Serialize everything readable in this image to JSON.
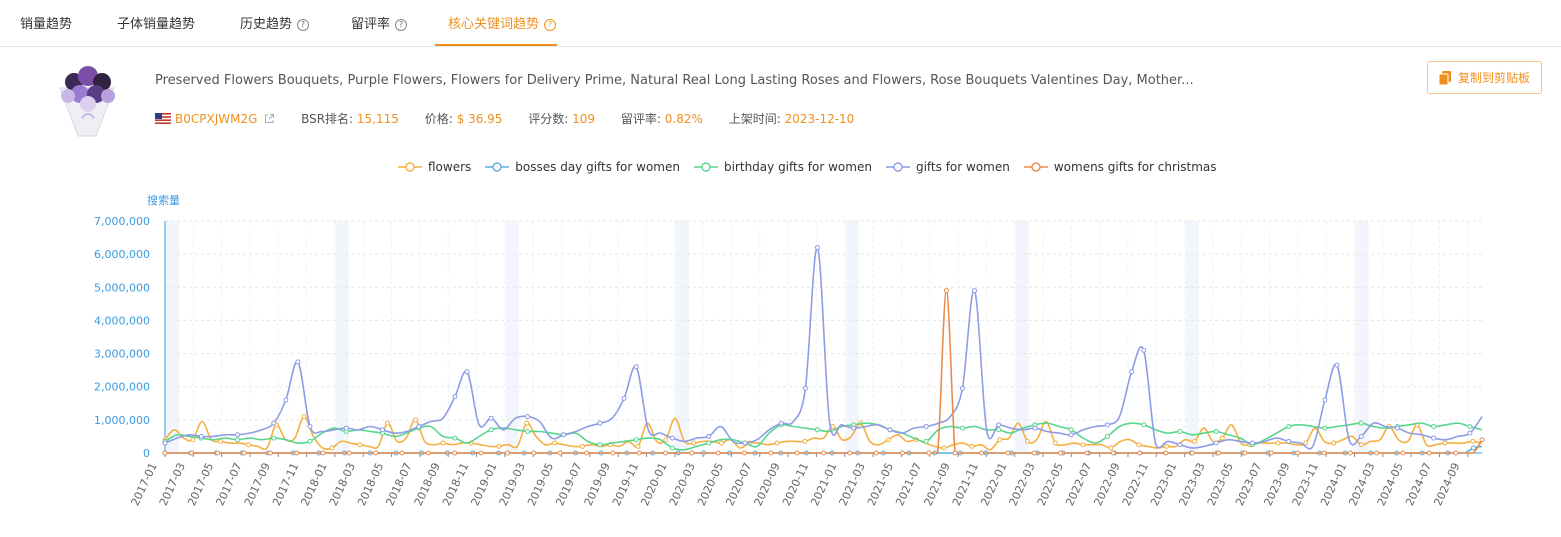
{
  "tabs": [
    {
      "label": "销量趋势",
      "help": false,
      "active": false
    },
    {
      "label": "子体销量趋势",
      "help": false,
      "active": false
    },
    {
      "label": "历史趋势",
      "help": true,
      "active": false
    },
    {
      "label": "留评率",
      "help": true,
      "active": false
    },
    {
      "label": "核心关键词趋势",
      "help": true,
      "active": true
    }
  ],
  "product": {
    "title": "Preserved Flowers Bouquets, Purple Flowers, Flowers for Delivery Prime, Natural Real Long Lasting Roses and Flowers, Rose Bouquets Valentines Day, Mother...",
    "asin": "B0CPXJWM2G",
    "bsr_label": "BSR排名:",
    "bsr_value": "15,115",
    "price_label": "价格:",
    "price_value": "$ 36.95",
    "reviews_label": "评分数:",
    "reviews_value": "109",
    "review_rate_label": "留评率:",
    "review_rate_value": "0.82%",
    "listed_label": "上架时间:",
    "listed_value": "2023-12-10"
  },
  "copy_button": {
    "label": "复制到剪贴板"
  },
  "colors": {
    "accent": "#f0901c",
    "axis": "#3a9be0"
  },
  "chart_data": {
    "type": "line",
    "ylabel": "搜索量",
    "ylim": [
      0,
      7000000
    ],
    "yticks": [
      "0",
      "1,000,000",
      "2,000,000",
      "3,000,000",
      "4,000,000",
      "5,000,000",
      "6,000,000",
      "7,000,000"
    ],
    "x_start": "2017-01",
    "x_end": "2024-10",
    "x_tick_labels": [
      "2017-01",
      "2017-03",
      "2017-05",
      "2017-07",
      "2017-09",
      "2017-11",
      "2018-01",
      "2018-03",
      "2018-05",
      "2018-07",
      "2018-09",
      "2018-11",
      "2019-01",
      "2019-03",
      "2019-05",
      "2019-07",
      "2019-09",
      "2019-11",
      "2020-01",
      "2020-03",
      "2020-05",
      "2020-07",
      "2020-09",
      "2020-11",
      "2021-01",
      "2021-03",
      "2021-05",
      "2021-07",
      "2021-09",
      "2021-11",
      "2022-01",
      "2022-03",
      "2022-05",
      "2022-07",
      "2022-09",
      "2022-11",
      "2023-01",
      "2023-03",
      "2023-05",
      "2023-07",
      "2023-09",
      "2023-11",
      "2024-01",
      "2024-03",
      "2024-05",
      "2024-07",
      "2024-09"
    ],
    "legend_position": "top",
    "series": [
      {
        "name": "flowers",
        "color": "#f5b041",
        "values": [
          400000,
          700000,
          450000,
          400000,
          950000,
          400000,
          350000,
          300000,
          300000,
          250000,
          200000,
          150000,
          850000,
          400000,
          450000,
          1100000,
          500000,
          150000,
          150000,
          350000,
          300000,
          250000,
          200000,
          200000,
          900000,
          350000,
          450000,
          1000000,
          350000,
          250000,
          300000,
          250000,
          300000,
          300000,
          250000,
          200000,
          200000,
          250000,
          200000,
          900000,
          500000,
          250000,
          300000,
          250000,
          200000,
          200000,
          250000,
          200000,
          250000,
          200000,
          350000,
          200000,
          900000,
          350000,
          400000,
          1050000,
          350000,
          300000,
          350000,
          350000,
          300000,
          400000,
          150000,
          300000,
          300000,
          250000,
          300000,
          350000,
          350000,
          350000,
          450000,
          450000,
          800000,
          400000,
          500000,
          900000,
          350000,
          250000,
          400000,
          550000,
          350000,
          400000,
          300000,
          200000,
          150000,
          250000,
          300000,
          200000,
          250000,
          100000,
          400000,
          450000,
          900000,
          350000,
          400000,
          950000,
          300000,
          250000,
          300000,
          250000,
          250000,
          250000,
          150000,
          350000,
          400000,
          250000,
          200000,
          150000,
          200000,
          200000,
          400000,
          350000,
          750000,
          350000,
          450000,
          850000,
          300000,
          250000,
          300000,
          300000,
          300000,
          300000,
          250000,
          300000,
          750000,
          350000,
          300000,
          400000,
          500000,
          250000,
          350000,
          400000,
          800000,
          400000,
          350000,
          850000,
          250000,
          250000,
          300000,
          300000,
          300000,
          350000,
          300000
        ]
      },
      {
        "name": "bosses day gifts for women",
        "color": "#5dade2",
        "values": [
          0,
          0,
          0,
          0,
          0,
          0,
          0,
          0,
          0,
          0,
          0,
          0,
          0,
          0,
          0,
          0,
          0,
          0,
          0,
          0,
          0,
          0,
          0,
          0,
          0,
          0,
          0,
          0,
          0,
          0,
          0,
          0,
          0,
          0,
          0,
          0,
          0,
          0,
          0,
          0,
          0,
          0,
          0,
          0,
          0,
          0,
          0,
          0,
          0,
          0,
          0,
          0,
          0,
          0,
          0,
          0,
          0,
          0,
          0,
          0,
          0,
          0,
          0,
          0,
          0,
          0,
          0,
          0,
          0,
          0,
          0,
          0,
          0,
          0,
          0,
          0,
          0,
          0,
          0,
          0,
          0,
          0,
          0,
          0,
          0,
          0,
          0,
          0,
          0,
          0,
          0,
          0,
          0,
          0,
          0,
          0,
          0,
          0,
          0,
          0,
          0,
          0,
          0,
          0,
          0,
          0,
          0,
          0,
          0,
          0,
          0,
          0,
          0,
          0,
          0,
          0,
          0,
          0,
          0,
          0,
          0,
          0,
          0,
          0,
          0,
          0,
          0,
          0,
          0,
          0,
          0,
          0,
          0,
          0,
          0,
          0,
          0,
          0,
          0,
          0,
          0,
          0,
          0,
          0,
          0,
          0,
          0,
          0,
          0,
          0,
          0,
          0,
          0,
          150000,
          200000
        ]
      },
      {
        "name": "birthday gifts for women",
        "color": "#58d68d",
        "values": [
          350000,
          550000,
          500000,
          450000,
          400000,
          450000,
          400000,
          450000,
          400000,
          450000,
          400000,
          300000,
          350000,
          600000,
          750000,
          650000,
          700000,
          650000,
          600000,
          500000,
          600000,
          750000,
          800000,
          500000,
          450000,
          300000,
          500000,
          700000,
          750000,
          700000,
          650000,
          650000,
          600000,
          550000,
          600000,
          350000,
          250000,
          300000,
          350000,
          400000,
          450000,
          400000,
          150000,
          100000,
          200000,
          300000,
          400000,
          400000,
          300000,
          200000,
          600000,
          850000,
          800000,
          750000,
          700000,
          650000,
          800000,
          850000,
          900000,
          850000,
          700000,
          600000,
          450000,
          350000,
          700000,
          800000,
          750000,
          800000,
          700000,
          700000,
          600000,
          750000,
          850000,
          900000,
          800000,
          700000,
          450000,
          300000,
          500000,
          800000,
          900000,
          850000,
          700000,
          600000,
          650000,
          550000,
          600000,
          650000,
          550000,
          450000,
          250000,
          400000,
          600000,
          800000,
          850000,
          800000,
          750000,
          800000,
          850000,
          900000,
          800000,
          750000,
          800000,
          850000,
          900000,
          800000,
          850000,
          900000,
          800000,
          700000
        ]
      },
      {
        "name": "gifts for women",
        "color": "#8e9ce6",
        "values": [
          300000,
          450000,
          550000,
          500000,
          500000,
          550000,
          550000,
          600000,
          700000,
          900000,
          1600000,
          2750000,
          800000,
          650000,
          700000,
          750000,
          700000,
          800000,
          700000,
          600000,
          650000,
          800000,
          950000,
          1050000,
          1700000,
          2450000,
          850000,
          1050000,
          700000,
          1050000,
          1100000,
          950000,
          450000,
          550000,
          650000,
          800000,
          900000,
          1050000,
          1650000,
          2600000,
          700000,
          600000,
          450000,
          350000,
          450000,
          500000,
          800000,
          350000,
          300000,
          400000,
          700000,
          900000,
          950000,
          1950000,
          6200000,
          950000,
          850000,
          750000,
          800000,
          850000,
          700000,
          600000,
          750000,
          800000,
          900000,
          1100000,
          1950000,
          4900000,
          700000,
          850000,
          750000,
          700000,
          750000,
          650000,
          600000,
          550000,
          700000,
          800000,
          850000,
          1100000,
          2450000,
          3100000,
          250000,
          350000,
          250000,
          150000,
          200000,
          300000,
          400000,
          350000,
          300000,
          350000,
          450000,
          350000,
          300000,
          200000,
          1600000,
          2650000,
          400000,
          500000,
          900000,
          800000,
          750000,
          600000,
          550000,
          450000,
          400000,
          500000,
          600000,
          1100000
        ]
      },
      {
        "name": "womens gifts for christmas",
        "color": "#eb8b4b",
        "values": [
          0,
          0,
          0,
          0,
          0,
          0,
          0,
          0,
          0,
          0,
          0,
          0,
          0,
          0,
          0,
          0,
          0,
          0,
          0,
          0,
          0,
          0,
          0,
          0,
          0,
          0,
          0,
          0,
          0,
          0,
          0,
          0,
          0,
          0,
          0,
          0,
          0,
          0,
          0,
          0,
          0,
          0,
          0,
          0,
          0,
          0,
          0,
          0,
          0,
          0,
          0,
          0,
          0,
          0,
          0,
          0,
          0,
          0,
          0,
          0,
          0,
          0,
          0,
          0,
          0,
          0,
          0,
          0,
          0,
          0,
          0,
          0,
          0,
          0,
          0,
          0,
          0,
          0,
          0,
          0,
          0,
          0,
          0,
          0,
          0,
          0,
          0,
          0,
          0,
          4900000,
          0,
          0,
          0,
          0,
          0,
          0,
          0,
          0,
          0,
          0,
          0,
          0,
          0,
          0,
          0,
          0,
          0,
          0,
          0,
          0,
          0,
          0,
          0,
          0,
          0,
          0,
          0,
          0,
          0,
          0,
          0,
          0,
          0,
          0,
          0,
          0,
          0,
          0,
          0,
          0,
          0,
          0,
          0,
          0,
          0,
          0,
          0,
          0,
          0,
          0,
          0,
          0,
          0,
          0,
          0,
          0,
          0,
          0,
          0,
          0,
          400000
        ]
      }
    ]
  }
}
